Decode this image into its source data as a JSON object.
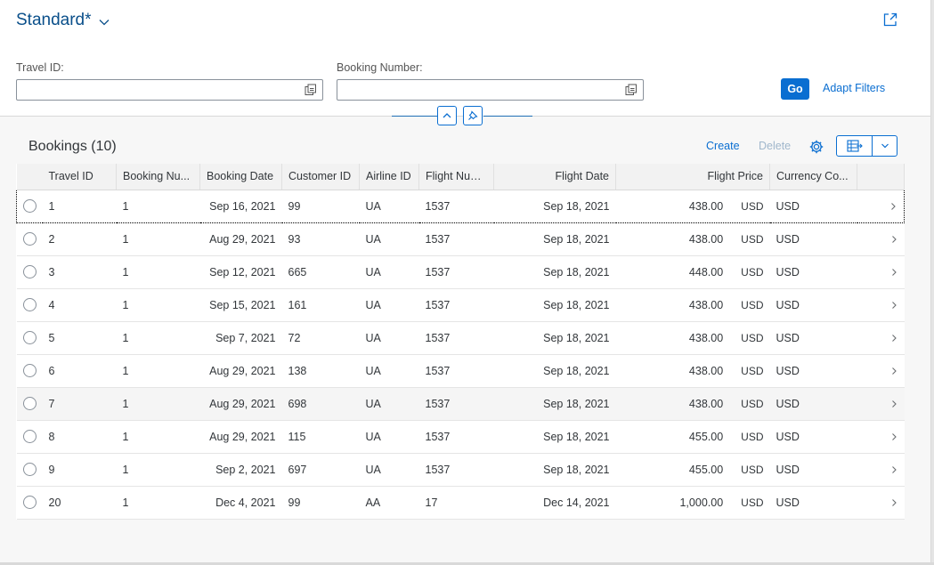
{
  "header": {
    "variant_title": "Standard*",
    "filters": [
      {
        "label": "Travel ID:",
        "value": "",
        "placeholder": ""
      },
      {
        "label": "Booking Number:",
        "value": "",
        "placeholder": ""
      }
    ],
    "go_label": "Go",
    "adapt_filters_label": "Adapt Filters"
  },
  "table": {
    "title": "Bookings (10)",
    "create_label": "Create",
    "delete_label": "Delete",
    "columns": [
      "Travel ID",
      "Booking Nu...",
      "Booking Date",
      "Customer ID",
      "Airline ID",
      "Flight Num...",
      "Flight Date",
      "Flight Price",
      "Currency Co..."
    ],
    "rows": [
      {
        "travel_id": "1",
        "booking_no": "1",
        "booking_date": "Sep 16, 2021",
        "customer_id": "99",
        "airline": "UA",
        "flight_no": "1537",
        "flight_date": "Sep 18, 2021",
        "price": "438.00",
        "price_currency": "USD",
        "currency_code": "USD"
      },
      {
        "travel_id": "2",
        "booking_no": "1",
        "booking_date": "Aug 29, 2021",
        "customer_id": "93",
        "airline": "UA",
        "flight_no": "1537",
        "flight_date": "Sep 18, 2021",
        "price": "438.00",
        "price_currency": "USD",
        "currency_code": "USD"
      },
      {
        "travel_id": "3",
        "booking_no": "1",
        "booking_date": "Sep 12, 2021",
        "customer_id": "665",
        "airline": "UA",
        "flight_no": "1537",
        "flight_date": "Sep 18, 2021",
        "price": "448.00",
        "price_currency": "USD",
        "currency_code": "USD"
      },
      {
        "travel_id": "4",
        "booking_no": "1",
        "booking_date": "Sep 15, 2021",
        "customer_id": "161",
        "airline": "UA",
        "flight_no": "1537",
        "flight_date": "Sep 18, 2021",
        "price": "438.00",
        "price_currency": "USD",
        "currency_code": "USD"
      },
      {
        "travel_id": "5",
        "booking_no": "1",
        "booking_date": "Sep 7, 2021",
        "customer_id": "72",
        "airline": "UA",
        "flight_no": "1537",
        "flight_date": "Sep 18, 2021",
        "price": "438.00",
        "price_currency": "USD",
        "currency_code": "USD"
      },
      {
        "travel_id": "6",
        "booking_no": "1",
        "booking_date": "Aug 29, 2021",
        "customer_id": "138",
        "airline": "UA",
        "flight_no": "1537",
        "flight_date": "Sep 18, 2021",
        "price": "438.00",
        "price_currency": "USD",
        "currency_code": "USD"
      },
      {
        "travel_id": "7",
        "booking_no": "1",
        "booking_date": "Aug 29, 2021",
        "customer_id": "698",
        "airline": "UA",
        "flight_no": "1537",
        "flight_date": "Sep 18, 2021",
        "price": "438.00",
        "price_currency": "USD",
        "currency_code": "USD"
      },
      {
        "travel_id": "8",
        "booking_no": "1",
        "booking_date": "Aug 29, 2021",
        "customer_id": "115",
        "airline": "UA",
        "flight_no": "1537",
        "flight_date": "Sep 18, 2021",
        "price": "455.00",
        "price_currency": "USD",
        "currency_code": "USD"
      },
      {
        "travel_id": "9",
        "booking_no": "1",
        "booking_date": "Sep 2, 2021",
        "customer_id": "697",
        "airline": "UA",
        "flight_no": "1537",
        "flight_date": "Sep 18, 2021",
        "price": "455.00",
        "price_currency": "USD",
        "currency_code": "USD"
      },
      {
        "travel_id": "20",
        "booking_no": "1",
        "booking_date": "Dec 4, 2021",
        "customer_id": "99",
        "airline": "AA",
        "flight_no": "17",
        "flight_date": "Dec 14, 2021",
        "price": "1,000.00",
        "price_currency": "USD",
        "currency_code": "USD"
      }
    ]
  },
  "icons": {
    "variant_dropdown": "chevron-down-icon",
    "share": "share-icon",
    "value_help": "value-help-icon",
    "collapse_header": "collapse-up-icon",
    "pin_header": "pin-icon",
    "settings": "gear-icon",
    "export": "export-spreadsheet-icon",
    "export_menu": "chevron-down-icon",
    "row_navigation": "chevron-right-icon"
  },
  "colors": {
    "brand_blue": "#0a6ed1",
    "title_blue": "#0a4f8a",
    "disabled_link": "#a0b7cc"
  }
}
